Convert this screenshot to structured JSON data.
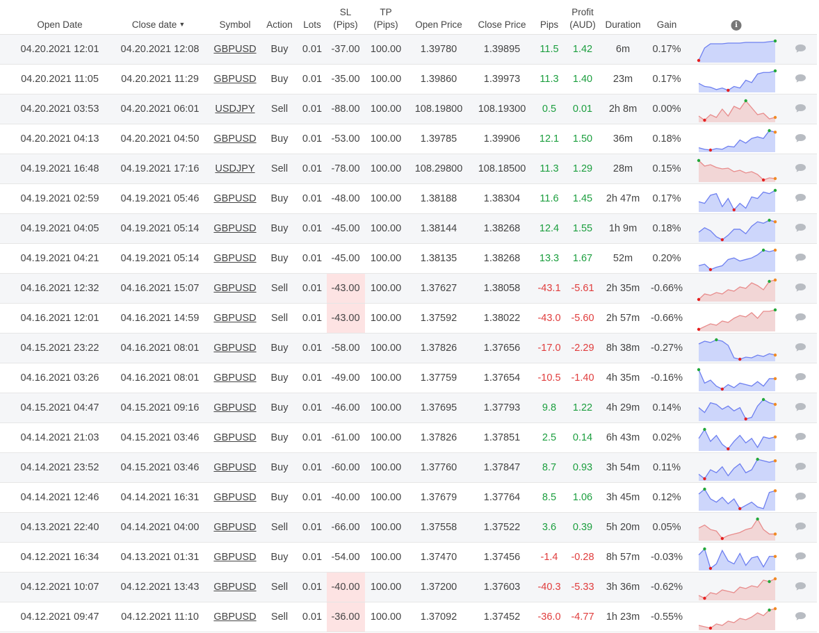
{
  "colors": {
    "positive": "#1b9e3e",
    "negative": "#e03c3c",
    "buy_fill": "#cdd6fb",
    "buy_line": "#6d7ff0",
    "sell_fill": "#f2d6d6",
    "sell_line": "#e88c8c",
    "sl_highlight": "#fde3e3"
  },
  "header": {
    "open_date": "Open Date",
    "close_date": "Close date",
    "sort_indicator": "▼",
    "symbol": "Symbol",
    "action": "Action",
    "lots": "Lots",
    "sl_line1": "SL",
    "sl_line2": "(Pips)",
    "tp_line1": "TP",
    "tp_line2": "(Pips)",
    "open_price": "Open Price",
    "close_price": "Close Price",
    "pips": "Pips",
    "profit_line1": "Profit",
    "profit_line2": "(AUD)",
    "duration": "Duration",
    "gain": "Gain",
    "info_icon": "i"
  },
  "rows": [
    {
      "open": "04.20.2021 12:01",
      "close": "04.20.2021 12:08",
      "symbol": "GBPUSD",
      "action": "Buy",
      "lots": "0.01",
      "sl": "-37.00",
      "tp": "100.00",
      "open_price": "1.39780",
      "close_price": "1.39895",
      "pips": "11.5",
      "profit": "1.42",
      "duration": "6m",
      "gain": "0.17%",
      "positive": true,
      "sl_hit": false,
      "spark": [
        2,
        20,
        26,
        26,
        26,
        27,
        27,
        27,
        28,
        28,
        28,
        28,
        29,
        30
      ],
      "min_i": 0,
      "max_i": 13,
      "end": "max"
    },
    {
      "open": "04.20.2021 11:05",
      "close": "04.20.2021 11:29",
      "symbol": "GBPUSD",
      "action": "Buy",
      "lots": "0.01",
      "sl": "-35.00",
      "tp": "100.00",
      "open_price": "1.39860",
      "close_price": "1.39973",
      "pips": "11.3",
      "profit": "1.40",
      "duration": "23m",
      "gain": "0.17%",
      "positive": true,
      "sl_hit": false,
      "spark": [
        14,
        10,
        9,
        6,
        8,
        5,
        10,
        8,
        18,
        15,
        26,
        28,
        28,
        30
      ],
      "min_i": 5,
      "max_i": 13,
      "end": "max"
    },
    {
      "open": "04.20.2021 03:53",
      "close": "04.20.2021 06:01",
      "symbol": "USDJPY",
      "action": "Sell",
      "lots": "0.01",
      "sl": "-88.00",
      "tp": "100.00",
      "open_price": "108.19800",
      "close_price": "108.19300",
      "pips": "0.5",
      "profit": "0.01",
      "duration": "2h 8m",
      "gain": "0.00%",
      "positive": true,
      "sl_hit": false,
      "spark": [
        8,
        2,
        10,
        6,
        18,
        8,
        22,
        18,
        30,
        20,
        10,
        12,
        4,
        6
      ],
      "min_i": 1,
      "max_i": 8,
      "end": "other"
    },
    {
      "open": "04.20.2021 04:13",
      "close": "04.20.2021 04:50",
      "symbol": "GBPUSD",
      "action": "Buy",
      "lots": "0.01",
      "sl": "-53.00",
      "tp": "100.00",
      "open_price": "1.39785",
      "close_price": "1.39906",
      "pips": "12.1",
      "profit": "1.50",
      "duration": "36m",
      "gain": "0.18%",
      "positive": true,
      "sl_hit": false,
      "spark": [
        8,
        6,
        5,
        7,
        6,
        10,
        9,
        18,
        14,
        20,
        22,
        20,
        30,
        28
      ],
      "min_i": 2,
      "max_i": 12,
      "end": "other"
    },
    {
      "open": "04.19.2021 16:48",
      "close": "04.19.2021 17:16",
      "symbol": "USDJPY",
      "action": "Sell",
      "lots": "0.01",
      "sl": "-78.00",
      "tp": "100.00",
      "open_price": "108.29800",
      "close_price": "108.18500",
      "pips": "11.3",
      "profit": "1.29",
      "duration": "28m",
      "gain": "0.15%",
      "positive": true,
      "sl_hit": false,
      "spark": [
        30,
        22,
        24,
        20,
        18,
        19,
        14,
        16,
        12,
        14,
        10,
        2,
        5,
        4
      ],
      "min_i": 11,
      "max_i": 0,
      "end": "other"
    },
    {
      "open": "04.19.2021 02:59",
      "close": "04.19.2021 05:46",
      "symbol": "GBPUSD",
      "action": "Buy",
      "lots": "0.01",
      "sl": "-48.00",
      "tp": "100.00",
      "open_price": "1.38188",
      "close_price": "1.38304",
      "pips": "11.6",
      "profit": "1.45",
      "duration": "2h 47m",
      "gain": "0.17%",
      "positive": true,
      "sl_hit": false,
      "spark": [
        16,
        14,
        24,
        26,
        10,
        20,
        6,
        14,
        8,
        22,
        20,
        28,
        26,
        30
      ],
      "min_i": 6,
      "max_i": 13,
      "end": "max"
    },
    {
      "open": "04.19.2021 04:05",
      "close": "04.19.2021 05:14",
      "symbol": "GBPUSD",
      "action": "Buy",
      "lots": "0.01",
      "sl": "-45.00",
      "tp": "100.00",
      "open_price": "1.38144",
      "close_price": "1.38268",
      "pips": "12.4",
      "profit": "1.55",
      "duration": "1h 9m",
      "gain": "0.18%",
      "positive": true,
      "sl_hit": false,
      "spark": [
        14,
        20,
        16,
        8,
        4,
        10,
        18,
        18,
        12,
        22,
        28,
        26,
        30,
        28
      ],
      "min_i": 4,
      "max_i": 12,
      "end": "other"
    },
    {
      "open": "04.19.2021 04:21",
      "close": "04.19.2021 05:14",
      "symbol": "GBPUSD",
      "action": "Buy",
      "lots": "0.01",
      "sl": "-45.00",
      "tp": "100.00",
      "open_price": "1.38135",
      "close_price": "1.38268",
      "pips": "13.3",
      "profit": "1.67",
      "duration": "52m",
      "gain": "0.20%",
      "positive": true,
      "sl_hit": false,
      "spark": [
        10,
        12,
        5,
        8,
        10,
        18,
        20,
        16,
        18,
        20,
        24,
        30,
        28,
        30
      ],
      "min_i": 2,
      "max_i": 11,
      "end": "other"
    },
    {
      "open": "04.16.2021 12:32",
      "close": "04.16.2021 15:07",
      "symbol": "GBPUSD",
      "action": "Sell",
      "lots": "0.01",
      "sl": "-43.00",
      "tp": "100.00",
      "open_price": "1.37627",
      "close_price": "1.38058",
      "pips": "-43.1",
      "profit": "-5.61",
      "duration": "2h 35m",
      "gain": "-0.66%",
      "positive": false,
      "sl_hit": true,
      "spark": [
        2,
        10,
        8,
        12,
        10,
        16,
        14,
        20,
        18,
        26,
        22,
        16,
        28,
        30
      ],
      "min_i": 0,
      "max_i": 12,
      "end": "other"
    },
    {
      "open": "04.16.2021 12:01",
      "close": "04.16.2021 14:59",
      "symbol": "GBPUSD",
      "action": "Sell",
      "lots": "0.01",
      "sl": "-43.00",
      "tp": "100.00",
      "open_price": "1.37592",
      "close_price": "1.38022",
      "pips": "-43.0",
      "profit": "-5.60",
      "duration": "2h 57m",
      "gain": "-0.66%",
      "positive": false,
      "sl_hit": true,
      "spark": [
        2,
        6,
        10,
        8,
        14,
        12,
        18,
        22,
        20,
        26,
        18,
        28,
        28,
        30
      ],
      "min_i": 0,
      "max_i": 13,
      "end": "max"
    },
    {
      "open": "04.15.2021 23:22",
      "close": "04.16.2021 08:01",
      "symbol": "GBPUSD",
      "action": "Buy",
      "lots": "0.01",
      "sl": "-58.00",
      "tp": "100.00",
      "open_price": "1.37826",
      "close_price": "1.37656",
      "pips": "-17.0",
      "profit": "-2.29",
      "duration": "8h 38m",
      "gain": "-0.27%",
      "positive": false,
      "sl_hit": false,
      "spark": [
        24,
        28,
        26,
        30,
        28,
        22,
        4,
        2,
        5,
        4,
        8,
        6,
        10,
        8
      ],
      "min_i": 7,
      "max_i": 3,
      "end": "other"
    },
    {
      "open": "04.16.2021 03:26",
      "close": "04.16.2021 08:01",
      "symbol": "GBPUSD",
      "action": "Buy",
      "lots": "0.01",
      "sl": "-49.00",
      "tp": "100.00",
      "open_price": "1.37759",
      "close_price": "1.37654",
      "pips": "-10.5",
      "profit": "-1.40",
      "duration": "4h 35m",
      "gain": "-0.16%",
      "positive": false,
      "sl_hit": false,
      "spark": [
        30,
        12,
        16,
        8,
        4,
        10,
        6,
        12,
        10,
        8,
        14,
        8,
        18,
        18
      ],
      "min_i": 4,
      "max_i": 0,
      "end": "other"
    },
    {
      "open": "04.15.2021 04:47",
      "close": "04.15.2021 09:16",
      "symbol": "GBPUSD",
      "action": "Buy",
      "lots": "0.01",
      "sl": "-46.00",
      "tp": "100.00",
      "open_price": "1.37695",
      "close_price": "1.37793",
      "pips": "9.8",
      "profit": "1.22",
      "duration": "4h 29m",
      "gain": "0.14%",
      "positive": true,
      "sl_hit": false,
      "spark": [
        18,
        12,
        24,
        22,
        16,
        20,
        14,
        18,
        4,
        6,
        20,
        28,
        24,
        22
      ],
      "min_i": 8,
      "max_i": 11,
      "end": "other"
    },
    {
      "open": "04.14.2021 21:03",
      "close": "04.15.2021 03:46",
      "symbol": "GBPUSD",
      "action": "Buy",
      "lots": "0.01",
      "sl": "-61.00",
      "tp": "100.00",
      "open_price": "1.37826",
      "close_price": "1.37851",
      "pips": "2.5",
      "profit": "0.14",
      "duration": "6h 43m",
      "gain": "0.02%",
      "positive": true,
      "sl_hit": false,
      "spark": [
        18,
        30,
        14,
        22,
        10,
        4,
        14,
        22,
        12,
        18,
        6,
        20,
        18,
        20
      ],
      "min_i": 5,
      "max_i": 1,
      "end": "other"
    },
    {
      "open": "04.14.2021 23:52",
      "close": "04.15.2021 03:46",
      "symbol": "GBPUSD",
      "action": "Buy",
      "lots": "0.01",
      "sl": "-60.00",
      "tp": "100.00",
      "open_price": "1.37760",
      "close_price": "1.37847",
      "pips": "8.7",
      "profit": "0.93",
      "duration": "3h 54m",
      "gain": "0.11%",
      "positive": true,
      "sl_hit": false,
      "spark": [
        10,
        4,
        16,
        12,
        20,
        8,
        18,
        24,
        12,
        16,
        30,
        28,
        26,
        28
      ],
      "min_i": 1,
      "max_i": 10,
      "end": "other"
    },
    {
      "open": "04.14.2021 12:46",
      "close": "04.14.2021 16:31",
      "symbol": "GBPUSD",
      "action": "Buy",
      "lots": "0.01",
      "sl": "-40.00",
      "tp": "100.00",
      "open_price": "1.37679",
      "close_price": "1.37764",
      "pips": "8.5",
      "profit": "1.06",
      "duration": "3h 45m",
      "gain": "0.12%",
      "positive": true,
      "sl_hit": false,
      "spark": [
        24,
        30,
        18,
        14,
        20,
        12,
        18,
        6,
        10,
        14,
        8,
        6,
        26,
        28
      ],
      "min_i": 7,
      "max_i": 1,
      "end": "other"
    },
    {
      "open": "04.13.2021 22:40",
      "close": "04.14.2021 04:00",
      "symbol": "GBPUSD",
      "action": "Sell",
      "lots": "0.01",
      "sl": "-66.00",
      "tp": "100.00",
      "open_price": "1.37558",
      "close_price": "1.37522",
      "pips": "3.6",
      "profit": "0.39",
      "duration": "5h 20m",
      "gain": "0.05%",
      "positive": true,
      "sl_hit": false,
      "spark": [
        18,
        22,
        16,
        14,
        4,
        8,
        10,
        12,
        16,
        18,
        30,
        16,
        10,
        10
      ],
      "min_i": 4,
      "max_i": 10,
      "end": "other"
    },
    {
      "open": "04.12.2021 16:34",
      "close": "04.13.2021 01:31",
      "symbol": "GBPUSD",
      "action": "Buy",
      "lots": "0.01",
      "sl": "-54.00",
      "tp": "100.00",
      "open_price": "1.37470",
      "close_price": "1.37456",
      "pips": "-1.4",
      "profit": "-0.28",
      "duration": "8h 57m",
      "gain": "-0.03%",
      "positive": false,
      "sl_hit": false,
      "spark": [
        22,
        30,
        4,
        10,
        28,
        14,
        10,
        24,
        8,
        18,
        20,
        6,
        20,
        20
      ],
      "min_i": 2,
      "max_i": 1,
      "end": "other"
    },
    {
      "open": "04.12.2021 10:07",
      "close": "04.12.2021 13:43",
      "symbol": "GBPUSD",
      "action": "Sell",
      "lots": "0.01",
      "sl": "-40.00",
      "tp": "100.00",
      "open_price": "1.37200",
      "close_price": "1.37603",
      "pips": "-40.3",
      "profit": "-5.33",
      "duration": "3h 36m",
      "gain": "-0.62%",
      "positive": false,
      "sl_hit": true,
      "spark": [
        6,
        2,
        10,
        8,
        14,
        12,
        10,
        18,
        16,
        20,
        18,
        28,
        26,
        30
      ],
      "min_i": 1,
      "max_i": 12,
      "end": "other"
    },
    {
      "open": "04.12.2021 09:47",
      "close": "04.12.2021 11:10",
      "symbol": "GBPUSD",
      "action": "Sell",
      "lots": "0.01",
      "sl": "-36.00",
      "tp": "100.00",
      "open_price": "1.37092",
      "close_price": "1.37452",
      "pips": "-36.0",
      "profit": "-4.77",
      "duration": "1h 23m",
      "gain": "-0.55%",
      "positive": false,
      "sl_hit": true,
      "spark": [
        6,
        4,
        2,
        8,
        6,
        12,
        10,
        16,
        14,
        18,
        24,
        20,
        28,
        30
      ],
      "min_i": 2,
      "max_i": 12,
      "end": "other"
    }
  ]
}
